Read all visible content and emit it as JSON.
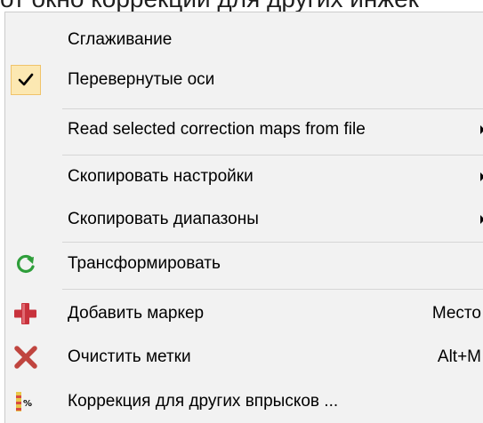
{
  "background_caption": "от окно коррекции для других инжек",
  "menu": {
    "items": [
      {
        "label": "Сглаживание",
        "shortcut": "",
        "has_submenu": false,
        "checked": false,
        "icon": ""
      },
      {
        "label": "Перевернутые оси",
        "shortcut": "",
        "has_submenu": false,
        "checked": true,
        "icon": "checkmark-icon"
      },
      {
        "label": "Read selected correction maps from file",
        "shortcut": "",
        "has_submenu": true,
        "checked": false,
        "icon": ""
      },
      {
        "label": "Скопировать настройки",
        "shortcut": "",
        "has_submenu": true,
        "checked": false,
        "icon": ""
      },
      {
        "label": "Скопировать диапазоны",
        "shortcut": "",
        "has_submenu": true,
        "checked": false,
        "icon": ""
      },
      {
        "label": "Трансформировать",
        "shortcut": "",
        "has_submenu": false,
        "checked": false,
        "icon": "green-refresh-icon"
      },
      {
        "label": "Добавить маркер",
        "shortcut": "Место",
        "has_submenu": false,
        "checked": false,
        "icon": "red-plus-icon"
      },
      {
        "label": "Очистить метки",
        "shortcut": "Alt+M",
        "has_submenu": false,
        "checked": false,
        "icon": "red-x-icon"
      },
      {
        "label": "Коррекция для других впрысков ...",
        "shortcut": "",
        "has_submenu": false,
        "checked": false,
        "icon": "percent-table-icon"
      }
    ]
  },
  "colors": {
    "menu_background": "#f2f2f2",
    "check_highlight": "#fce8b2",
    "icon_green": "#2e9e3a",
    "icon_red": "#c8323c",
    "icon_red_x": "#c0453f"
  }
}
